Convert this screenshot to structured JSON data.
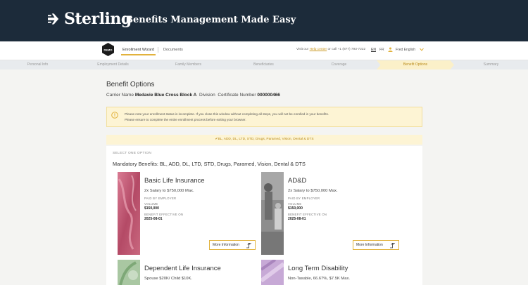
{
  "banner": {
    "brand": "Sterling",
    "tagline": "Benefits Management Made Easy"
  },
  "nav": {
    "demo_badge": "DEMO",
    "tabs": [
      "Enrollment Wizard",
      "Documents"
    ],
    "help_prefix": "Visit our",
    "help_link": "Help center",
    "help_suffix": "or call +1 (877) 793-7222",
    "lang_en": "EN",
    "lang_fr": "FR",
    "user_name": "Fred English"
  },
  "steps": [
    "Personal Info",
    "Employment Details",
    "Family Members",
    "Beneficiaries",
    "Coverage",
    "Benefit Options",
    "Summary"
  ],
  "page": {
    "title": "Benefit Options",
    "carrier_label": "Carrier Name",
    "carrier_value": "Medavie Blue Cross Block A",
    "division_label": "Division",
    "certificate_label": "Certificate Number",
    "certificate_value": "000000466"
  },
  "warning": {
    "line1": "Please note your enrollment status is incomplete. If you close this window without completing all steps, you will not be enrolled in your benefits.",
    "line2": "Please ensure to complete the entire enrollment process before exiting your browser."
  },
  "bundle_banner": "✔BL, ADD, DL, LTD, STD, Drugs, Paramed, Vision, Dental & DTS",
  "panel": {
    "select_one": "SELECT ONE OPTION",
    "mandatory": "Mandatory Benefits: BL, ADD, DL, LTD, STD, Drugs, Paramed, Vision, Dental & DTS"
  },
  "cards": [
    {
      "title": "Basic Life Insurance",
      "subtitle": "2x Salary to $750,000 Max.",
      "paid_by": "PAID BY EMPLOYER",
      "volume_label": "VOLUME",
      "volume": "$150,000",
      "effective_label": "BENEFIT EFFECTIVE ON",
      "effective": "2025-08-01",
      "button": "More Information"
    },
    {
      "title": "AD&D",
      "subtitle": "2x Salary to $750,000 Max.",
      "paid_by": "PAID BY EMPLOYER",
      "volume_label": "VOLUME",
      "volume": "$150,000",
      "effective_label": "BENEFIT EFFECTIVE ON",
      "effective": "2025-08-01",
      "button": "More Information"
    },
    {
      "title": "Dependent Life Insurance",
      "subtitle": "Spouse $20K/ Child $10K."
    },
    {
      "title": "Long Term Disability",
      "subtitle": "Non-Taxable, 66.67%, $7.5K Max."
    }
  ],
  "colors": {
    "accent": "#e2b23c",
    "banner_bg": "#1c2b3a",
    "warning_bg": "#fdf4d4"
  },
  "icons": [
    "sterling-arrow-icon",
    "demo-badge-icon",
    "user-icon",
    "chevron-down-icon",
    "warning-icon",
    "external-arrow-icon"
  ]
}
